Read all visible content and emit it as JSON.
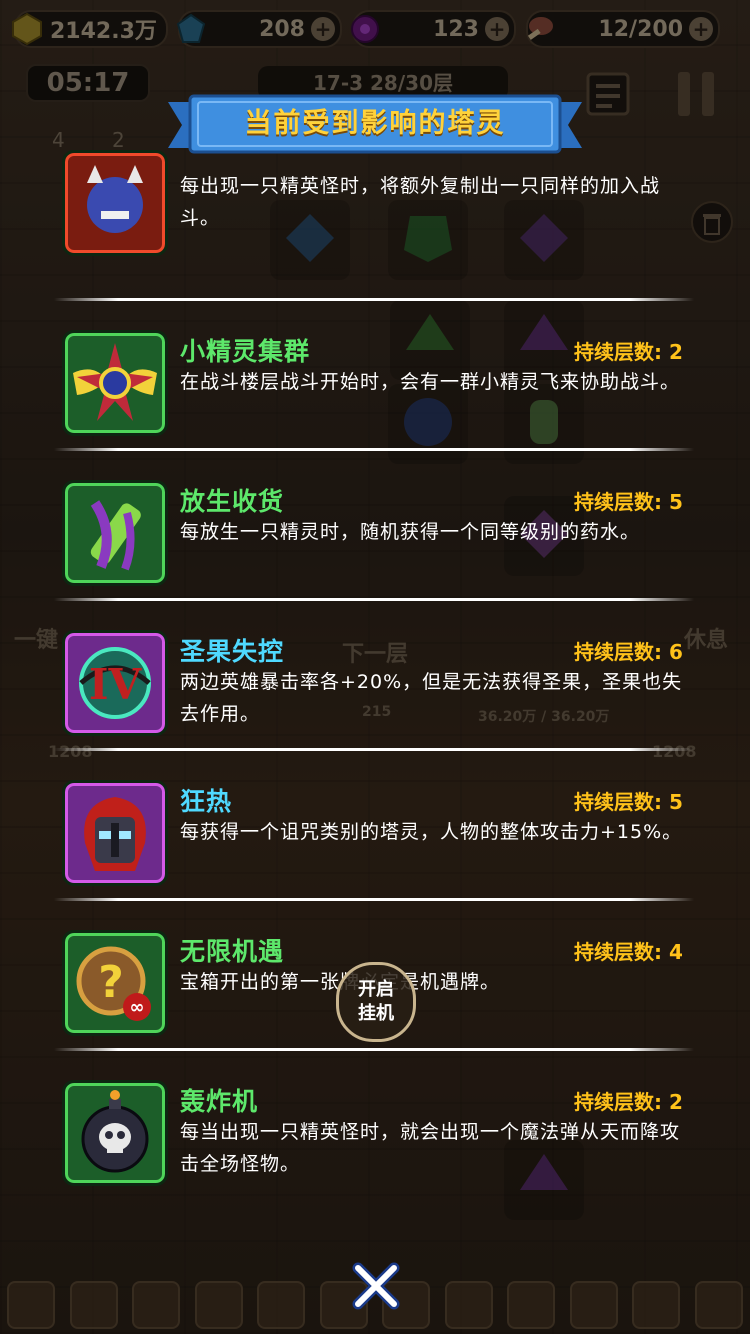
{
  "resources": {
    "gold": "2142.3万",
    "gems": "208",
    "orbs": "123",
    "stamina": "12/200"
  },
  "timer": "05:17",
  "floor_strip": "17-3  28/30层",
  "left_stat": "4",
  "right_stat": "2",
  "background_labels": {
    "next_floor": "下一层",
    "one_key": "一键",
    "rest": "休息",
    "floor_left": "1208",
    "floor_right": "1208",
    "level_215": "215",
    "hp": "36.20万 / 36.20万"
  },
  "dialog": {
    "title": "当前受到影响的塔灵",
    "duration_label": "持续层数: ",
    "entries": [
      {
        "name": "",
        "duration": "",
        "description": "每出现一只精英怪时，将额外复制出一只同样的加入战斗。",
        "icon": "elite-demon-icon"
      },
      {
        "name": "小精灵集群",
        "duration": "持续层数: 2",
        "description": "在战斗楼层战斗开始时，会有一群小精灵飞来协助战斗。",
        "icon": "fairy-swarm-icon"
      },
      {
        "name": "放生收货",
        "duration": "持续层数: 5",
        "description": "每放生一只精灵时，随机获得一个同等级别的药水。",
        "icon": "release-harvest-icon"
      },
      {
        "name": "圣果失控",
        "duration": "持续层数: 6",
        "description": "两边英雄暴击率各+20%，但是无法获得圣果，圣果也失去作用。",
        "icon": "roman-four-icon"
      },
      {
        "name": "狂热",
        "duration": "持续层数: 5",
        "description": "每获得一个诅咒类别的塔灵，人物的整体攻击力+15%。",
        "icon": "fervor-helmet-icon"
      },
      {
        "name": "无限机遇",
        "duration": "持续层数: 4",
        "description": "宝箱开出的第一张牌必定是机遇牌。",
        "icon": "infinite-chance-icon"
      },
      {
        "name": "轰炸机",
        "duration": "持续层数: 2",
        "description": "每当出现一只精英怪时，就会出现一个魔法弹从天而降攻击全场怪物。",
        "icon": "skull-bomb-icon"
      }
    ]
  },
  "auto_button": {
    "line1": "开启",
    "line2": "挂机"
  },
  "colors": {
    "name_green": "#5de86b",
    "name_cyan": "#4fd9ff",
    "duration_gold": "#ffc21a",
    "banner_blue": "#3f8fe0",
    "banner_text": "#ffd23a"
  }
}
